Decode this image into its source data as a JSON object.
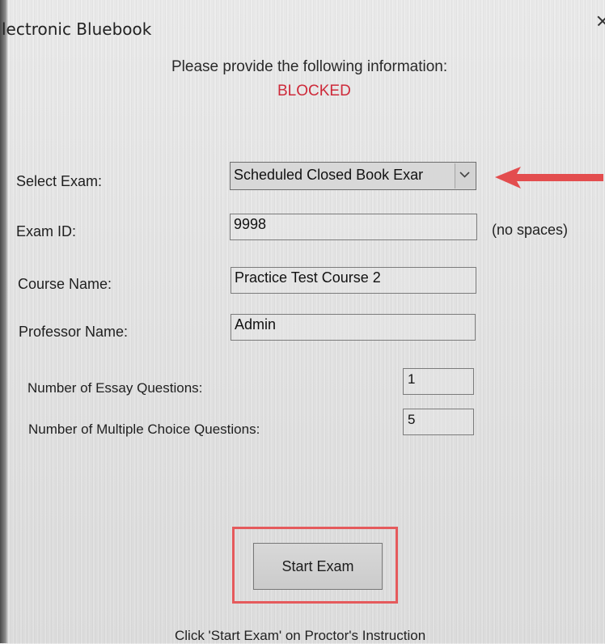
{
  "window": {
    "title": "lectronic Bluebook",
    "close_icon": "close-icon"
  },
  "header": {
    "prompt": "Please provide the following information:",
    "status": "BLOCKED",
    "status_color": "#ce2a3a"
  },
  "form": {
    "select_exam": {
      "label": "Select Exam:",
      "value": "Scheduled Closed Book Exar"
    },
    "exam_id": {
      "label": "Exam ID:",
      "value": "9998",
      "hint": "(no spaces)"
    },
    "course_name": {
      "label": "Course Name:",
      "value": "Practice Test Course 2"
    },
    "professor_name": {
      "label": "Professor Name:",
      "value": "Admin"
    },
    "essay_questions": {
      "label": "Number of Essay Questions:",
      "value": "1"
    },
    "multiple_choice_questions": {
      "label": "Number of Multiple Choice Questions:",
      "value": "5"
    }
  },
  "actions": {
    "start_exam_label": "Start Exam"
  },
  "footer": {
    "instruction": "Click 'Start Exam' on Proctor's Instruction"
  },
  "annotations": {
    "highlight_color": "#e55a5c",
    "arrow_icon": "left-arrow-icon"
  }
}
